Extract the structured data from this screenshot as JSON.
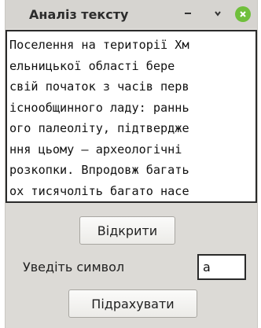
{
  "window": {
    "title": "Аналіз тексту",
    "minimize_symbol": "–",
    "maximize_symbol": "⌄"
  },
  "text_area": {
    "lines": [
      "Поселення на території Хм",
      "ельницької області бере",
      "свій початок з часів перв",
      "існообщинного ладу: раннь",
      "ого палеоліту, підтвердже",
      "ння цьому – археологічні",
      "розкопки. Впродовж багать",
      "ох тисячоліть багато насе"
    ]
  },
  "open_button": {
    "label": "Відкрити"
  },
  "symbol": {
    "label": "Уведіть символ",
    "value": "а"
  },
  "count_button": {
    "label": "Підрахувати"
  },
  "colors": {
    "window_bg": "#dcdad6",
    "close_button": "#6fbf3b"
  }
}
